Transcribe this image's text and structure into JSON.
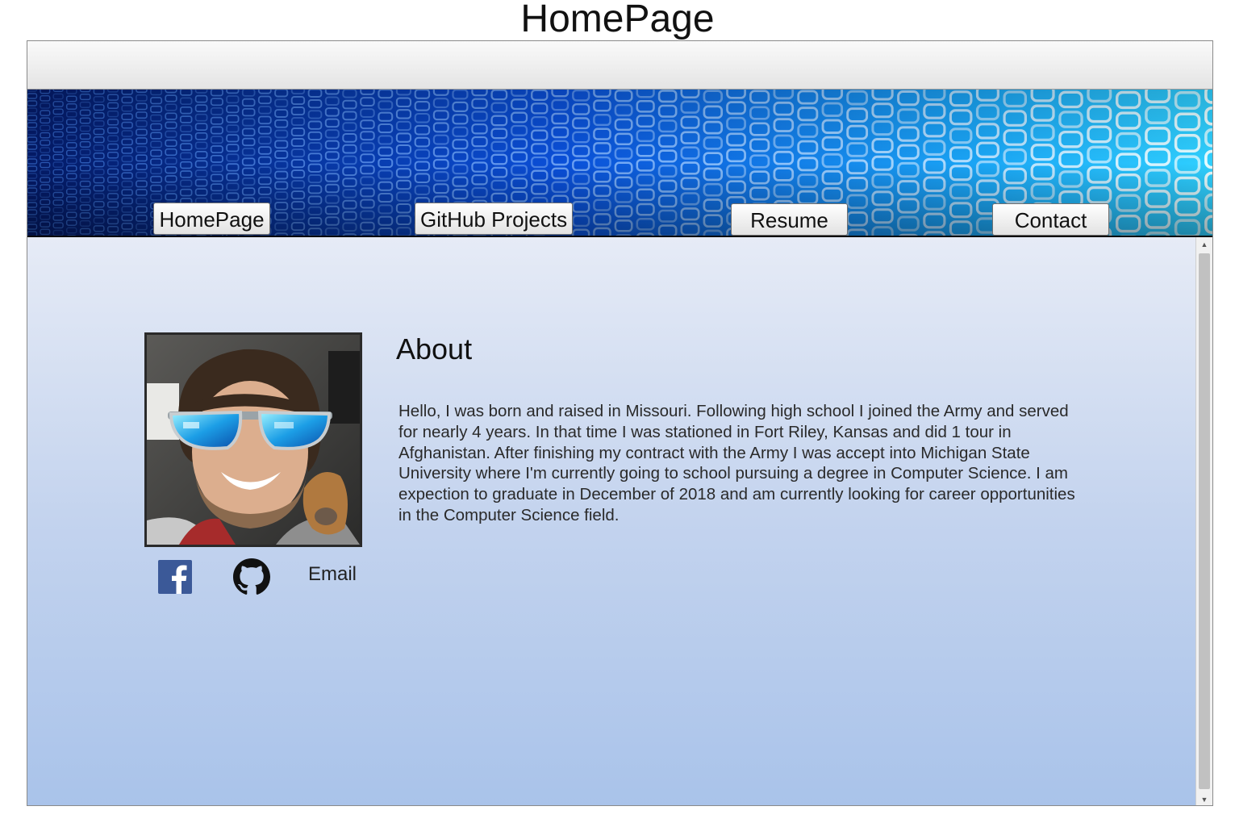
{
  "page": {
    "title": "HomePage"
  },
  "nav": {
    "items": [
      {
        "label": "HomePage"
      },
      {
        "label": "GitHub Projects"
      },
      {
        "label": "Resume"
      },
      {
        "label": "Contact"
      }
    ]
  },
  "about": {
    "heading": "About",
    "body": "Hello, I was born and raised in Missouri. Following high school I joined the Army and served for nearly 4 years. In that time I was stationed in Fort Riley, Kansas and did 1 tour in Afghanistan. After finishing my contract with the Army I was accept into Michigan State University where I'm currently going to school pursuing a degree in Computer Science. I am expection to graduate in December of 2018 and am currently looking for career opportunities in the Computer Science field."
  },
  "social": {
    "facebook_icon": "facebook-icon",
    "github_icon": "github-icon",
    "email_label": "Email"
  },
  "colors": {
    "banner_blue": "#0a4fd8",
    "banner_cyan": "#35d6ff",
    "content_top": "#e6ebf6",
    "content_bottom": "#a9c3ea",
    "facebook_blue": "#3b5998"
  }
}
